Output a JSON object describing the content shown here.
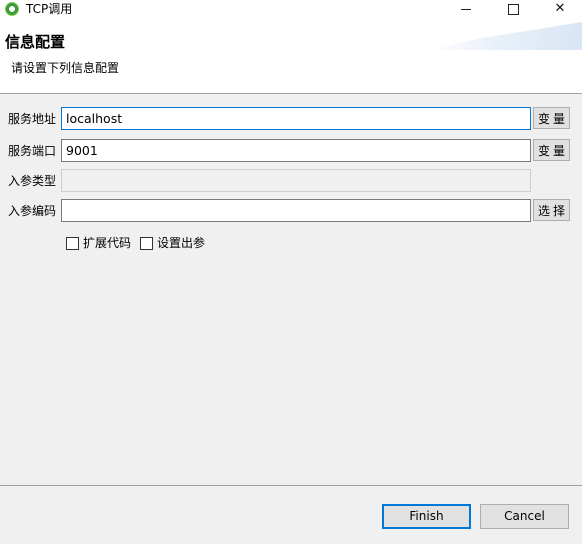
{
  "window": {
    "title": "TCP调用"
  },
  "header": {
    "title": "信息配置",
    "description": "请设置下列信息配置"
  },
  "form": {
    "service_address": {
      "label": "服务地址",
      "value": "localhost",
      "button": "变量"
    },
    "service_port": {
      "label": "服务端口",
      "value": "9001",
      "button": "变量"
    },
    "input_type": {
      "label": "入参类型",
      "value": ""
    },
    "input_encoding": {
      "label": "入参编码",
      "value": "",
      "button": "选择"
    }
  },
  "options": {
    "extend_code": {
      "label": "扩展代码",
      "checked": false
    },
    "set_output_param": {
      "label": "设置出参",
      "checked": false
    }
  },
  "footer": {
    "finish_label": "Finish",
    "cancel_label": "Cancel"
  },
  "colors": {
    "focus_accent": "#0078d7",
    "dialog_bg": "#f0f0f0"
  }
}
